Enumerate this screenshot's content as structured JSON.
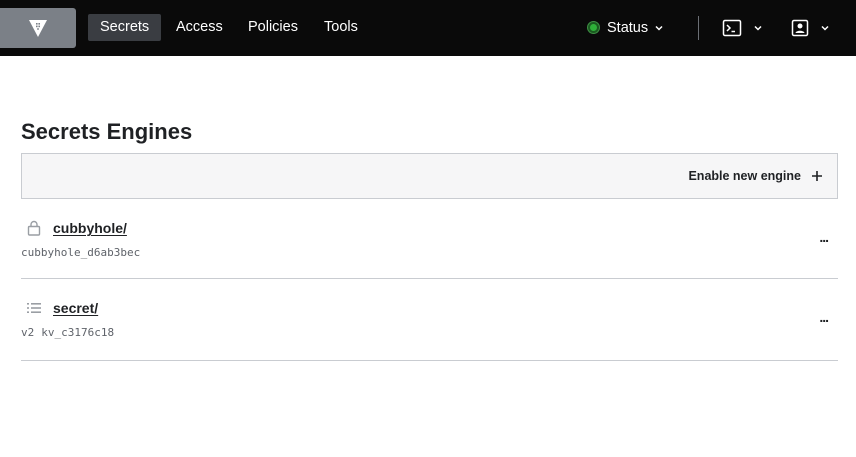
{
  "nav": {
    "items": [
      {
        "label": "Secrets",
        "active": true
      },
      {
        "label": "Access",
        "active": false
      },
      {
        "label": "Policies",
        "active": false
      },
      {
        "label": "Tools",
        "active": false
      }
    ],
    "status_label": "Status",
    "status_color": "#2eb039",
    "logo_icon": "vault-logo-icon",
    "console_icon": "terminal-icon",
    "user_icon": "user-icon"
  },
  "main": {
    "title": "Secrets Engines",
    "enable_label": "Enable new engine",
    "engines": [
      {
        "path": "cubbyhole/",
        "version": "",
        "accessor": "cubbyhole_d6ab3bec",
        "icon": "lock-icon"
      },
      {
        "path": "secret/",
        "version": "v2",
        "accessor": "kv_c3176c18",
        "icon": "list-icon"
      }
    ],
    "row_menu_label": "..."
  }
}
